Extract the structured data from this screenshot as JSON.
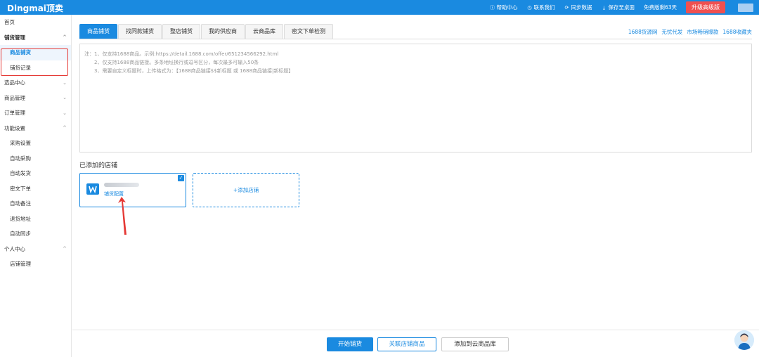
{
  "app": {
    "logo": "Dingmai顶卖"
  },
  "topnav": {
    "items": [
      {
        "icon": "info-icon",
        "label": "帮助中心"
      },
      {
        "icon": "clock-icon",
        "label": "联系我们"
      },
      {
        "icon": "sync-icon",
        "label": "同步数据"
      },
      {
        "icon": "download-icon",
        "label": "保存至桌面"
      }
    ],
    "trial": "免费版剩63天",
    "upgrade": "升级高级版"
  },
  "sidebar": {
    "items": [
      {
        "label": "首页",
        "type": "top"
      },
      {
        "label": "铺货管理",
        "type": "group",
        "chevron": "^"
      },
      {
        "label": "商品铺货",
        "type": "sub",
        "active": true
      },
      {
        "label": "铺货记录",
        "type": "sub"
      },
      {
        "label": "选品中心",
        "type": "group",
        "chevron": "v"
      },
      {
        "label": "商品管理",
        "type": "group",
        "chevron": "v"
      },
      {
        "label": "订单管理",
        "type": "group",
        "chevron": "v"
      },
      {
        "label": "功能设置",
        "type": "group",
        "chevron": "^"
      },
      {
        "label": "采购设置",
        "type": "sub"
      },
      {
        "label": "自动采购",
        "type": "sub"
      },
      {
        "label": "自动发货",
        "type": "sub"
      },
      {
        "label": "密文下单",
        "type": "sub"
      },
      {
        "label": "自动备注",
        "type": "sub"
      },
      {
        "label": "退货地址",
        "type": "sub"
      },
      {
        "label": "自动同步",
        "type": "sub"
      },
      {
        "label": "个人中心",
        "type": "group",
        "chevron": "^"
      },
      {
        "label": "店铺管理",
        "type": "sub"
      }
    ]
  },
  "tabs": [
    "商品铺货",
    "找同款铺货",
    "整店铺货",
    "我的供应商",
    "云商品库",
    "密文下单检测"
  ],
  "right_links": [
    "1688货源网",
    "无忧代发",
    "市场畅销爆款",
    "1688收藏夹"
  ],
  "note": {
    "line1": "注：1、仅支持1688商品。示例:https://detail.1688.com/offer/651234566292.html",
    "line2": "2、仅支持1688商品链接。多条地址换行或逗号区分，每次最多可输入50条",
    "line3": "3、需要自定义标题时，上传格式为：【1688商品链接$$新标题 或 1688商品链接|新标题】"
  },
  "shops": {
    "title": "已添加的店铺",
    "card": {
      "config_label": "铺货配置",
      "checked": true
    },
    "add_label": "+添加店铺"
  },
  "footer": {
    "start": "开始铺货",
    "link": "关联店铺商品",
    "add_cloud": "添加到云商品库"
  }
}
